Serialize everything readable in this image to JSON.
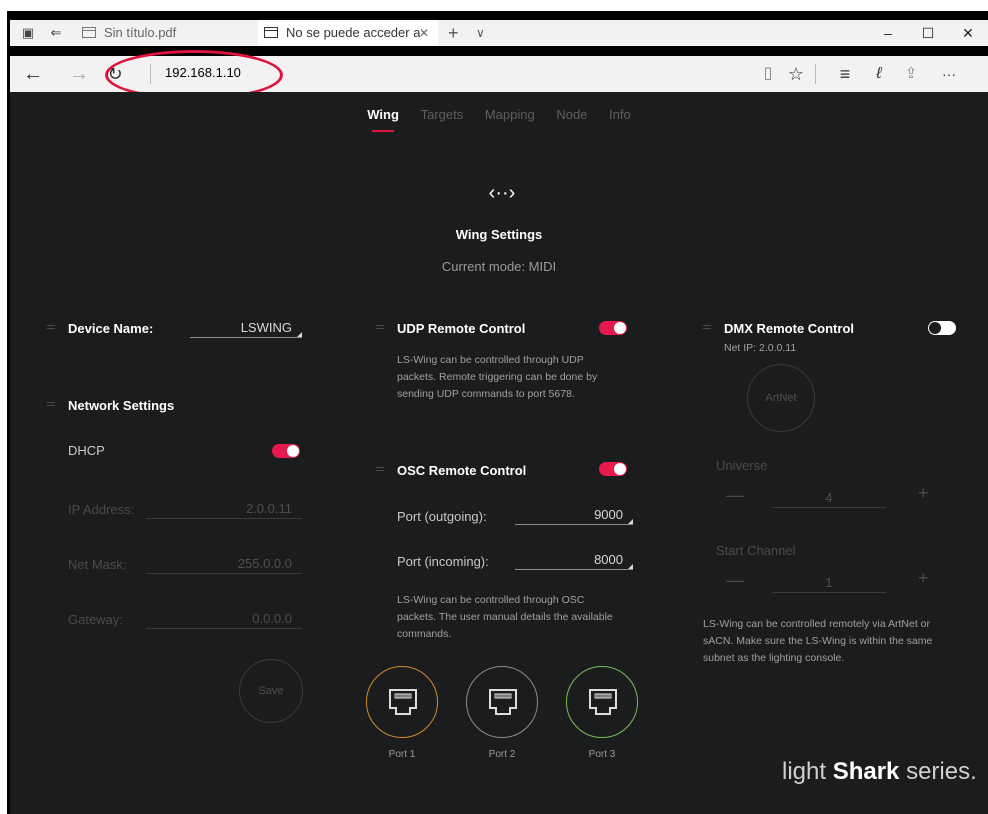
{
  "browser": {
    "tabs": [
      {
        "title": "Sin título.pdf",
        "active": false
      },
      {
        "title": "No se puede acceder a",
        "active": true
      }
    ],
    "address": "192.168.1.10",
    "new_tab": "+",
    "tab_menu": "∨",
    "close_tab": "✕",
    "window": {
      "min": "–",
      "max": "☐",
      "close": "✕"
    },
    "more": "···"
  },
  "app": {
    "nav": [
      "Wing",
      "Targets",
      "Mapping",
      "Node",
      "Info"
    ],
    "active_nav": "Wing",
    "header": {
      "icon": "‹··›",
      "title": "Wing Settings",
      "mode": "Current mode: MIDI"
    },
    "device": {
      "label": "Device Name:",
      "value": "LSWING"
    },
    "network": {
      "title": "Network Settings",
      "dhcp_label": "DHCP",
      "dhcp_on": true,
      "ip_label": "IP Address:",
      "ip": "2.0.0.11",
      "mask_label": "Net Mask:",
      "mask": "255.0.0.0",
      "gw_label": "Gateway:",
      "gw": "0.0.0.0",
      "save": "Save"
    },
    "udp": {
      "title": "UDP Remote Control",
      "on": true,
      "desc": [
        "LS-Wing can be controlled through UDP",
        "packets. Remote triggering can be done by",
        "sending UDP commands to port 5678."
      ]
    },
    "osc": {
      "title": "OSC Remote Control",
      "on": true,
      "out_label": "Port (outgoing):",
      "out": "9000",
      "in_label": "Port (incoming):",
      "in": "8000",
      "desc": [
        "LS-Wing can be controlled through OSC",
        "packets. The user manual details the available",
        "commands."
      ]
    },
    "ports": [
      {
        "label": "Port 1",
        "color": "#d58a2a"
      },
      {
        "label": "Port 2",
        "color": "#8a8a8a"
      },
      {
        "label": "Port 3",
        "color": "#7bbf55"
      }
    ],
    "dmx": {
      "title": "DMX Remote Control",
      "on": false,
      "net_ip": "Net IP: 2.0.0.11",
      "artnet": "ArtNet",
      "universe_label": "Universe",
      "universe": "4",
      "channel_label": "Start Channel",
      "channel": "1",
      "minus": "—",
      "plus": "+",
      "desc": [
        "LS-Wing can be controlled remotely via ArtNet or",
        "sACN. Make sure the LS-Wing is within the same",
        "subnet as the lighting console."
      ]
    },
    "brand": {
      "a": "light ",
      "b": "Shark",
      "c": " series."
    }
  }
}
